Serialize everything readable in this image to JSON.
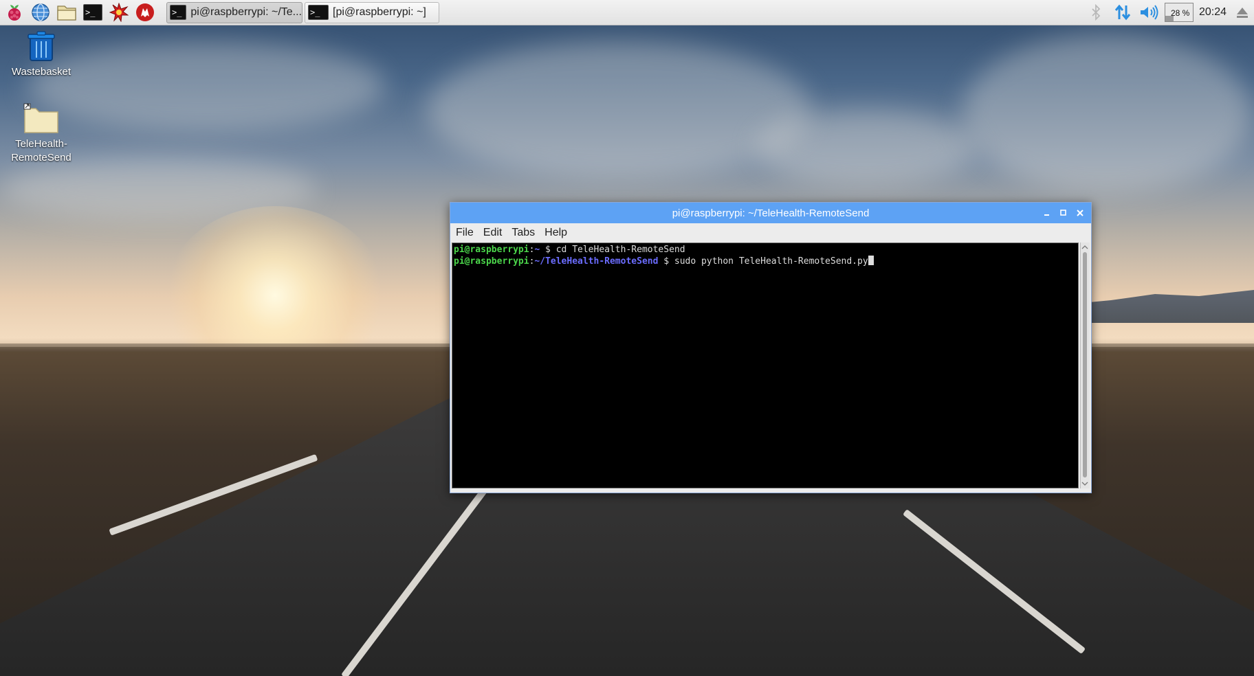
{
  "taskbar": {
    "launchers": [
      {
        "icon": "raspberry-menu-icon"
      },
      {
        "icon": "web-browser-icon"
      },
      {
        "icon": "file-manager-icon"
      },
      {
        "icon": "terminal-icon"
      },
      {
        "icon": "mathematica-icon"
      },
      {
        "icon": "wolfram-icon"
      }
    ],
    "tasks": [
      {
        "label": "pi@raspberrypi: ~/Te...",
        "active": true
      },
      {
        "label": "[pi@raspberrypi: ~]",
        "active": false
      }
    ],
    "tray": {
      "cpu_percent": "28 %",
      "clock": "20:24"
    }
  },
  "desktop": {
    "icons": [
      {
        "label": "Wastebasket",
        "icon": "trash-icon"
      },
      {
        "label": "TeleHealth-\nRemoteSend",
        "icon": "folder-icon"
      }
    ]
  },
  "terminal": {
    "title": "pi@raspberrypi: ~/TeleHealth-RemoteSend",
    "menu": [
      "File",
      "Edit",
      "Tabs",
      "Help"
    ],
    "lines": [
      {
        "user": "pi@raspberrypi",
        "path": "~",
        "command": "cd TeleHealth-RemoteSend"
      },
      {
        "user": "pi@raspberrypi",
        "path": "~/TeleHealth-RemoteSend",
        "command": "sudo python TeleHealth-RemoteSend.py"
      }
    ]
  },
  "colors": {
    "titlebar": "#5da2f4",
    "prompt_user": "#4bd64b",
    "prompt_path": "#6b6cff"
  }
}
